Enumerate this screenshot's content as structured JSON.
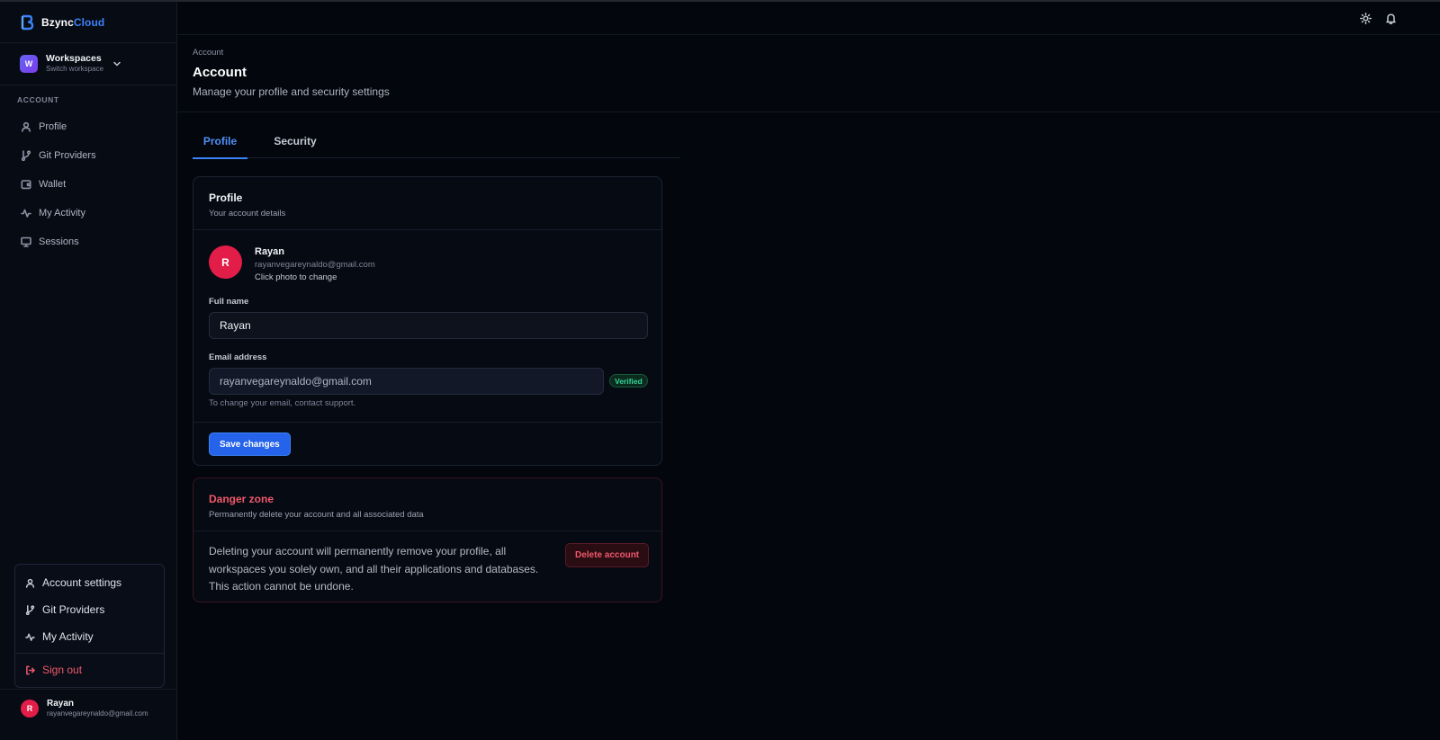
{
  "brand": {
    "name_main": "Bzync",
    "name_accent": "Cloud"
  },
  "workspace": {
    "avatar_letter": "W",
    "name": "Workspaces",
    "subtitle": "Switch workspace"
  },
  "sidebar": {
    "section_label": "ACCOUNT",
    "items": [
      {
        "label": "Profile",
        "icon": "user-icon"
      },
      {
        "label": "Git Providers",
        "icon": "git-branch-icon"
      },
      {
        "label": "Wallet",
        "icon": "wallet-icon"
      },
      {
        "label": "My Activity",
        "icon": "activity-icon"
      },
      {
        "label": "Sessions",
        "icon": "monitor-icon"
      }
    ]
  },
  "account_menu": {
    "items": [
      {
        "label": "Account settings",
        "icon": "user-icon"
      },
      {
        "label": "Git Providers",
        "icon": "git-branch-icon"
      },
      {
        "label": "My Activity",
        "icon": "activity-icon"
      }
    ],
    "sign_out": {
      "label": "Sign out",
      "icon": "sign-out-icon"
    }
  },
  "current_user": {
    "avatar_letter": "R",
    "name": "Rayan",
    "email": "rayanvegareynaldo@gmail.com"
  },
  "topbar": {
    "icons": [
      "sun-icon",
      "bell-icon"
    ]
  },
  "header": {
    "breadcrumb": "Account",
    "title": "Account",
    "subtitle": "Manage your profile and security settings"
  },
  "tabs": [
    {
      "label": "Profile",
      "active": true
    },
    {
      "label": "Security",
      "active": false
    }
  ],
  "profile_card": {
    "title": "Profile",
    "description": "Your account details",
    "avatar_letter": "R",
    "name": "Rayan",
    "email": "rayanvegareynaldo@gmail.com",
    "photo_hint": "Click photo to change",
    "full_name_label": "Full name",
    "full_name_value": "Rayan",
    "email_label": "Email address",
    "email_value": "rayanvegareynaldo@gmail.com",
    "verified_badge": "Verified",
    "email_help": "To change your email, contact support.",
    "save_label": "Save changes"
  },
  "danger_card": {
    "title": "Danger zone",
    "description": "Permanently delete your account and all associated data",
    "warning": "Deleting your account will permanently remove your profile, all workspaces you solely own, and all their applications and databases. This action cannot be undone.",
    "delete_label": "Delete account"
  },
  "colors": {
    "accent": "#3b82f6",
    "danger": "#f0586a",
    "success": "#34d399",
    "avatar_user": "#e11d48",
    "avatar_workspace": "#6366f1",
    "background": "#03060d"
  }
}
